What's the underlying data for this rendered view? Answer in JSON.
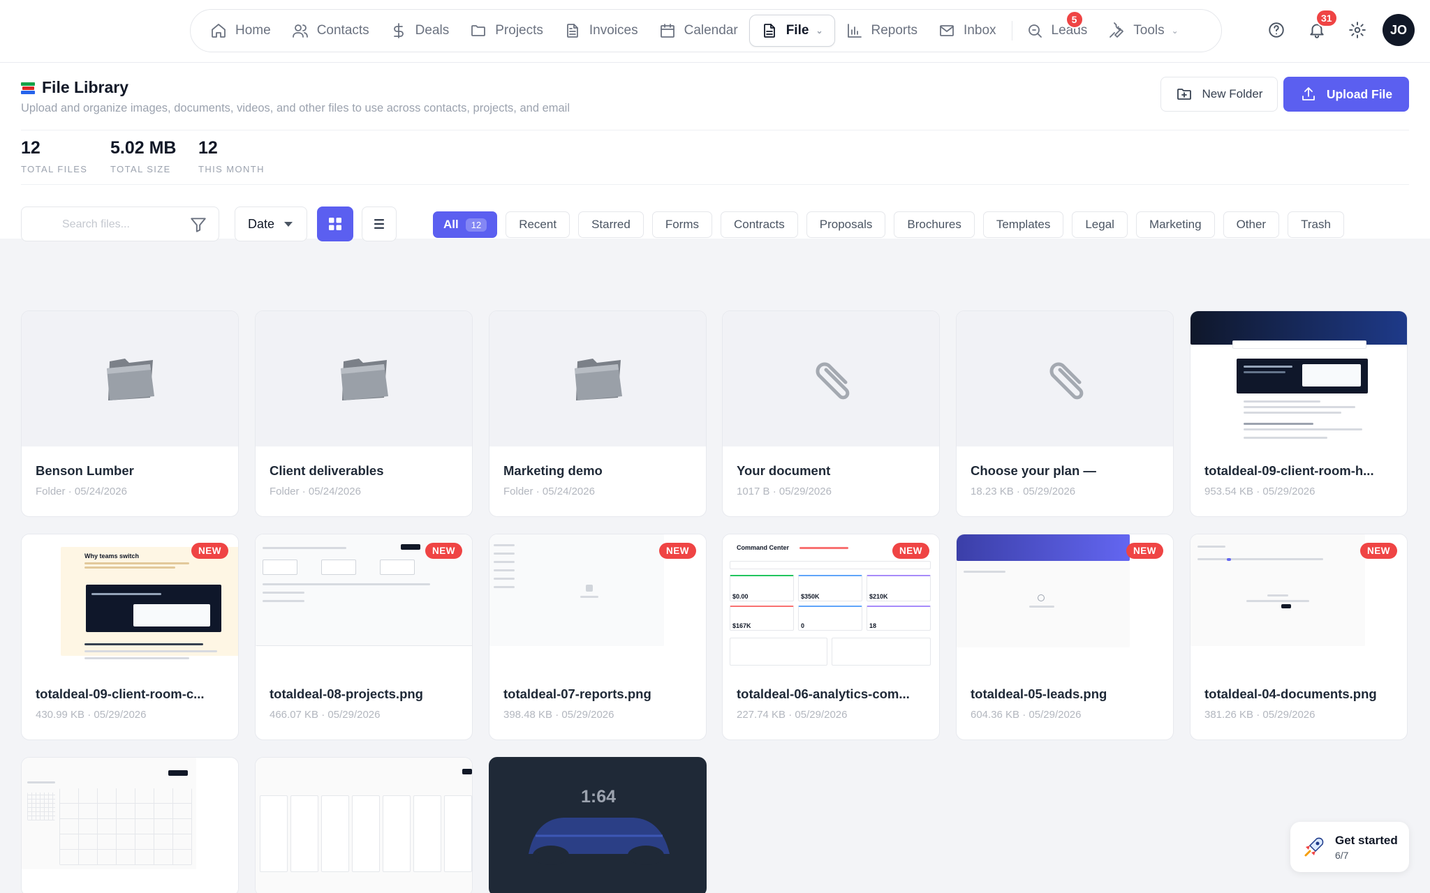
{
  "nav": {
    "items": [
      {
        "label": "Home",
        "icon": "home-icon"
      },
      {
        "label": "Contacts",
        "icon": "users-icon"
      },
      {
        "label": "Deals",
        "icon": "dollar-icon"
      },
      {
        "label": "Projects",
        "icon": "folder-icon"
      },
      {
        "label": "Invoices",
        "icon": "document-icon"
      },
      {
        "label": "Calendar",
        "icon": "calendar-icon"
      },
      {
        "label": "File",
        "icon": "file-icon",
        "active": true
      },
      {
        "label": "Reports",
        "icon": "bar-chart-icon"
      },
      {
        "label": "Inbox",
        "icon": "mail-icon"
      },
      {
        "label": "Leads",
        "icon": "search-icon",
        "badge": "5"
      },
      {
        "label": "Tools",
        "icon": "wrench-icon"
      }
    ],
    "notifications_badge": "31",
    "avatar_initials": "JO"
  },
  "header": {
    "title": "File Library",
    "subtitle": "Upload and organize images, documents, videos, and other files to use across contacts, projects, and email",
    "new_folder_label": "New Folder",
    "upload_label": "Upload File"
  },
  "stats": [
    {
      "value": "12",
      "label": "TOTAL FILES"
    },
    {
      "value": "5.02 MB",
      "label": "TOTAL SIZE"
    },
    {
      "value": "12",
      "label": "THIS MONTH"
    }
  ],
  "toolbar": {
    "search_placeholder": "Search files...",
    "sort_label": "Date",
    "filters": [
      {
        "label": "All",
        "count": "12",
        "active": true
      },
      {
        "label": "Recent"
      },
      {
        "label": "Starred"
      },
      {
        "label": "Forms"
      },
      {
        "label": "Contracts"
      },
      {
        "label": "Proposals"
      },
      {
        "label": "Brochures"
      },
      {
        "label": "Templates"
      },
      {
        "label": "Legal"
      },
      {
        "label": "Marketing"
      },
      {
        "label": "Other"
      },
      {
        "label": "Trash"
      }
    ]
  },
  "files": [
    {
      "name": "Benson Lumber",
      "type": "Folder",
      "date": "05/24/2026"
    },
    {
      "name": "Client deliverables",
      "type": "Folder",
      "date": "05/24/2026"
    },
    {
      "name": "Marketing demo",
      "type": "Folder",
      "date": "05/24/2026"
    },
    {
      "name": "Your document",
      "size": "1017 B",
      "date": "05/29/2026"
    },
    {
      "name": "Choose your plan —",
      "size": "18.23 KB",
      "date": "05/29/2026"
    },
    {
      "name": "totaldeal-09-client-room-h...",
      "size": "953.54 KB",
      "date": "05/29/2026"
    },
    {
      "name": "totaldeal-09-client-room-c...",
      "size": "430.99 KB",
      "date": "05/29/2026",
      "new": "NEW"
    },
    {
      "name": "totaldeal-08-projects.png",
      "size": "466.07 KB",
      "date": "05/29/2026",
      "new": "NEW"
    },
    {
      "name": "totaldeal-07-reports.png",
      "size": "398.48 KB",
      "date": "05/29/2026",
      "new": "NEW"
    },
    {
      "name": "totaldeal-06-analytics-com...",
      "size": "227.74 KB",
      "date": "05/29/2026",
      "new": "NEW"
    },
    {
      "name": "totaldeal-05-leads.png",
      "size": "604.36 KB",
      "date": "05/29/2026",
      "new": "NEW"
    },
    {
      "name": "totaldeal-04-documents.png",
      "size": "381.26 KB",
      "date": "05/29/2026",
      "new": "NEW"
    }
  ],
  "video_duration": "1:64",
  "thumb_texts": {
    "hero_heading": "Why teams switch",
    "command_center": "Command Center",
    "cc_values": [
      "$0.00",
      "$350K",
      "$210K",
      "$167K",
      "0",
      "18"
    ]
  },
  "get_started": {
    "title": "Get started",
    "progress": "6/7"
  },
  "colors": {
    "accent": "#5b5ff0",
    "badge": "#ef4444",
    "text": "#111827",
    "muted": "#9ca3af"
  }
}
